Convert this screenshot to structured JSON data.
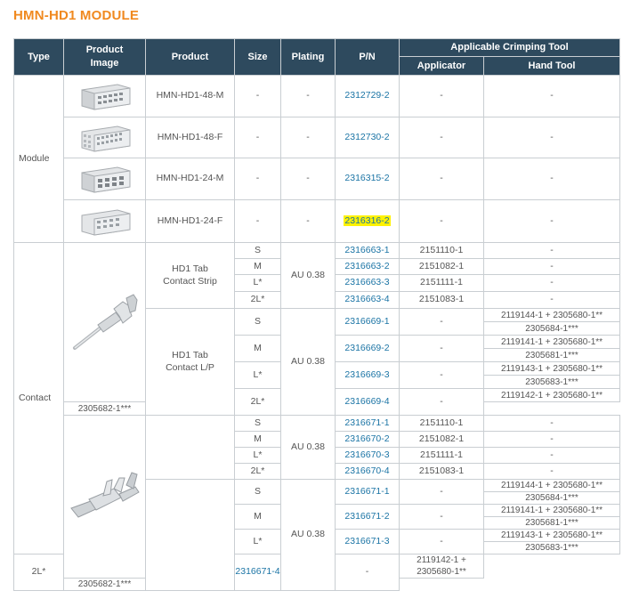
{
  "title": "HMN-HD1 MODULE",
  "headers": {
    "type": "Type",
    "image_line1": "Product",
    "image_line2": "Image",
    "product": "Product",
    "size": "Size",
    "plating": "Plating",
    "pn": "P/N",
    "tool_group": "Applicable Crimping Tool",
    "applicator": "Applicator",
    "hand_tool": "Hand Tool"
  },
  "module": {
    "type": "Module",
    "rows": [
      {
        "product": "HMN-HD1-48-M",
        "size": "-",
        "plating": "-",
        "pn": "2312729-2",
        "applicator": "-",
        "hand_tool": "-",
        "image": "module-male-connector-image"
      },
      {
        "product": "HMN-HD1-48-F",
        "size": "-",
        "plating": "-",
        "pn": "2312730-2",
        "applicator": "-",
        "hand_tool": "-",
        "image": "module-female-connector-image"
      },
      {
        "product": "HMN-HD1-24-M",
        "size": "-",
        "plating": "-",
        "pn": "2316315-2",
        "applicator": "-",
        "hand_tool": "-",
        "image": "module-male-connector-image"
      },
      {
        "product": "HMN-HD1-24-F",
        "size": "-",
        "plating": "-",
        "pn": "2316316-2",
        "applicator": "-",
        "hand_tool": "-",
        "image": "module-female-connector-image",
        "highlight": "#fff200"
      }
    ]
  },
  "contact": {
    "type": "Contact",
    "plating": "AU 0.38",
    "tab_strip": {
      "product_line1": "HD1 Tab",
      "product_line2": "Contact Strip",
      "rows": [
        {
          "size": "S",
          "pn": "2316663-1",
          "applicator": "2151110-1",
          "hand_tool": "-"
        },
        {
          "size": "M",
          "pn": "2316663-2",
          "applicator": "2151082-1",
          "hand_tool": "-"
        },
        {
          "size": "L*",
          "pn": "2316663-3",
          "applicator": "2151111-1",
          "hand_tool": "-"
        },
        {
          "size": "2L*",
          "pn": "2316663-4",
          "applicator": "2151083-1",
          "hand_tool": "-"
        }
      ]
    },
    "tab_lp": {
      "product_line1": "HD1 Tab",
      "product_line2": "Contact L/P",
      "rows": [
        {
          "size": "S",
          "pn": "2316669-1",
          "applicator": "-",
          "hand_tool_1": "2119144-1 + 2305680-1**",
          "hand_tool_2": "2305684-1***"
        },
        {
          "size": "M",
          "pn": "2316669-2",
          "applicator": "-",
          "hand_tool_1": "2119141-1 + 2305680-1**",
          "hand_tool_2": "2305681-1***"
        },
        {
          "size": "L*",
          "pn": "2316669-3",
          "applicator": "-",
          "hand_tool_1": "2119143-1 + 2305680-1**",
          "hand_tool_2": "2305683-1***"
        },
        {
          "size": "2L*",
          "pn": "2316669-4",
          "applicator": "-",
          "hand_tool_1": "2119142-1 + 2305680-1**",
          "hand_tool_2": "2305682-1***"
        }
      ]
    },
    "receptacle_strip": {
      "rows": [
        {
          "size": "S",
          "pn": "2316671-1",
          "applicator": "2151110-1",
          "hand_tool": "-"
        },
        {
          "size": "M",
          "pn": "2316670-2",
          "applicator": "2151082-1",
          "hand_tool": "-"
        },
        {
          "size": "L*",
          "pn": "2316670-3",
          "applicator": "2151111-1",
          "hand_tool": "-"
        },
        {
          "size": "2L*",
          "pn": "2316670-4",
          "applicator": "2151083-1",
          "hand_tool": "-"
        }
      ]
    },
    "receptacle_lp": {
      "rows": [
        {
          "size": "S",
          "pn": "2316671-1",
          "applicator": "-",
          "hand_tool_1": "2119144-1 + 2305680-1**",
          "hand_tool_2": "2305684-1***"
        },
        {
          "size": "M",
          "pn": "2316671-2",
          "applicator": "-",
          "hand_tool_1": "2119141-1 + 2305680-1**",
          "hand_tool_2": "2305681-1***"
        },
        {
          "size": "L*",
          "pn": "2316671-3",
          "applicator": "-",
          "hand_tool_1": "2119143-1 + 2305680-1**",
          "hand_tool_2": "2305683-1***"
        },
        {
          "size": "2L*",
          "pn": "2316671-4",
          "applicator": "-",
          "hand_tool_1": "2119142-1 + 2305680-1**",
          "hand_tool_2": "2305682-1***"
        }
      ]
    },
    "images": [
      "tab-contact-image",
      "receptacle-contact-image"
    ]
  }
}
